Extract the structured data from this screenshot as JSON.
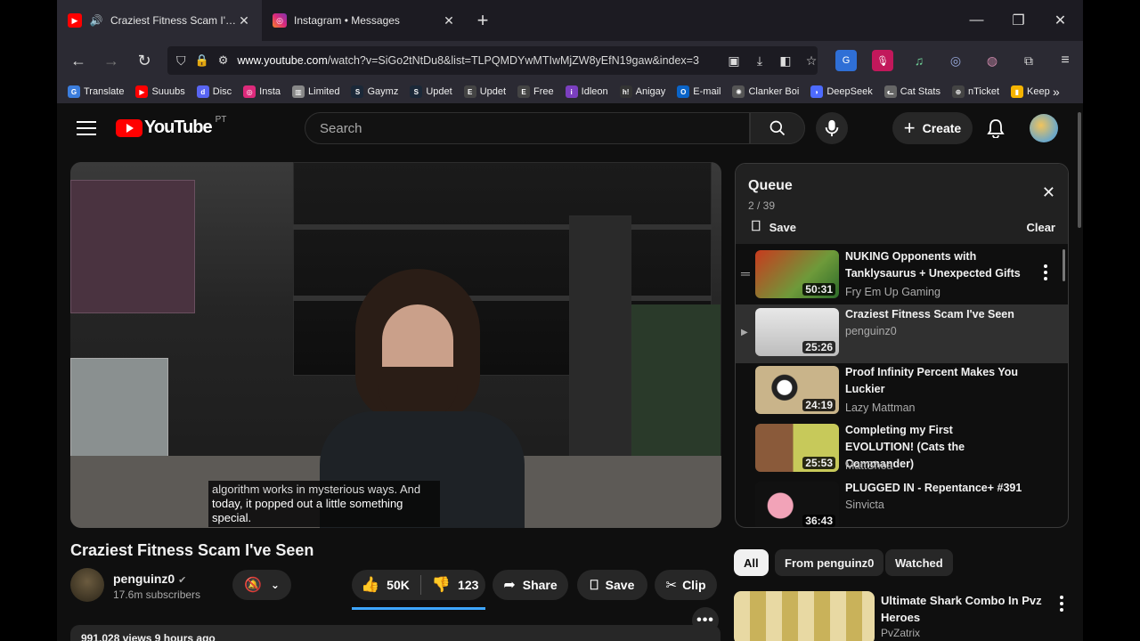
{
  "browser": {
    "tabs": [
      {
        "title": "Craziest Fitness Scam I've Seen - YouTube",
        "favicon": "youtube-icon",
        "active": true
      },
      {
        "title": "Instagram • Messages",
        "favicon": "instagram-icon",
        "active": false
      }
    ],
    "url_domain": "www.youtube.com",
    "url_rest": "/watch?v=SiGo2tNtDu8&list=TLPQMDYwMTIwMjZW8yEfN19gaw&index=3",
    "bookmarks": [
      "Translate",
      "Suuubs",
      "Disc",
      "Insta",
      "Limited",
      "Gaymz",
      "Updet",
      "Updet",
      "Free",
      "Idleon",
      "Anigay",
      "E-mail",
      "Clanker Boi",
      "DeepSeek",
      "Cat Stats",
      "nTicket",
      "Keep"
    ]
  },
  "youtube": {
    "logo": "YouTube",
    "country": "PT",
    "search_placeholder": "Search",
    "create_label": "Create"
  },
  "video": {
    "title": "Craziest Fitness Scam I've Seen",
    "subtitle_line1": "algorithm works in mysterious ways. And",
    "subtitle_line2": "today, it popped out a little something",
    "subtitle_line3": "special.",
    "channel": "penguinz0",
    "subscribers": "17.6m subscribers",
    "likes": "50K",
    "dislikes": "123",
    "share_label": "Share",
    "save_label": "Save",
    "clip_label": "Clip",
    "views": "991,028 views  9 hours ago"
  },
  "queue": {
    "title": "Queue",
    "position": "2 / 39",
    "save_label": "Save",
    "clear_label": "Clear",
    "items": [
      {
        "title": "NUKING Opponents with Tanklysaurus + Unexpected Gifts",
        "channel": "Fry Em Up Gaming",
        "duration": "50:31"
      },
      {
        "title": "Craziest Fitness Scam I've Seen",
        "channel": "penguinz0",
        "duration": "25:26"
      },
      {
        "title": "Proof Infinity Percent Makes You Luckier",
        "channel": "Lazy Mattman",
        "duration": "24:19"
      },
      {
        "title": "Completing my First EVOLUTION! (Cats the Commander)",
        "channel": "MattShea",
        "duration": "25:53"
      },
      {
        "title": "PLUGGED IN - Repentance+ #391",
        "channel": "Sinvicta",
        "duration": "36:43"
      }
    ]
  },
  "chips": [
    "All",
    "From penguinz0",
    "Watched"
  ],
  "recommendation": {
    "title_line1": "Ultimate Shark Combo In Pvz",
    "title_line2": "Heroes",
    "channel": "PvZatrix"
  }
}
